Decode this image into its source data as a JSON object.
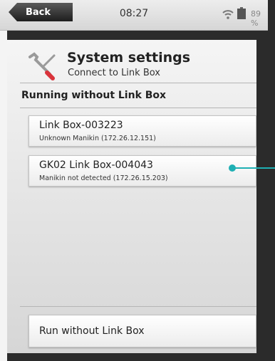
{
  "statusbar": {
    "back_label": "Back",
    "time": "08:27",
    "battery_pct": "89 %"
  },
  "header": {
    "title": "System settings",
    "subtitle": "Connect to Link Box"
  },
  "section_title": "Running without Link Box",
  "devices": [
    {
      "name": "Link Box-003223",
      "detail": "Unknown Manikin (172.26.12.151)"
    },
    {
      "name": "GK02 Link Box-004043",
      "detail": "Manikin not detected (172.26.15.203)"
    }
  ],
  "run_button_label": "Run without Link Box",
  "colors": {
    "pointer": "#1fb0b4"
  }
}
